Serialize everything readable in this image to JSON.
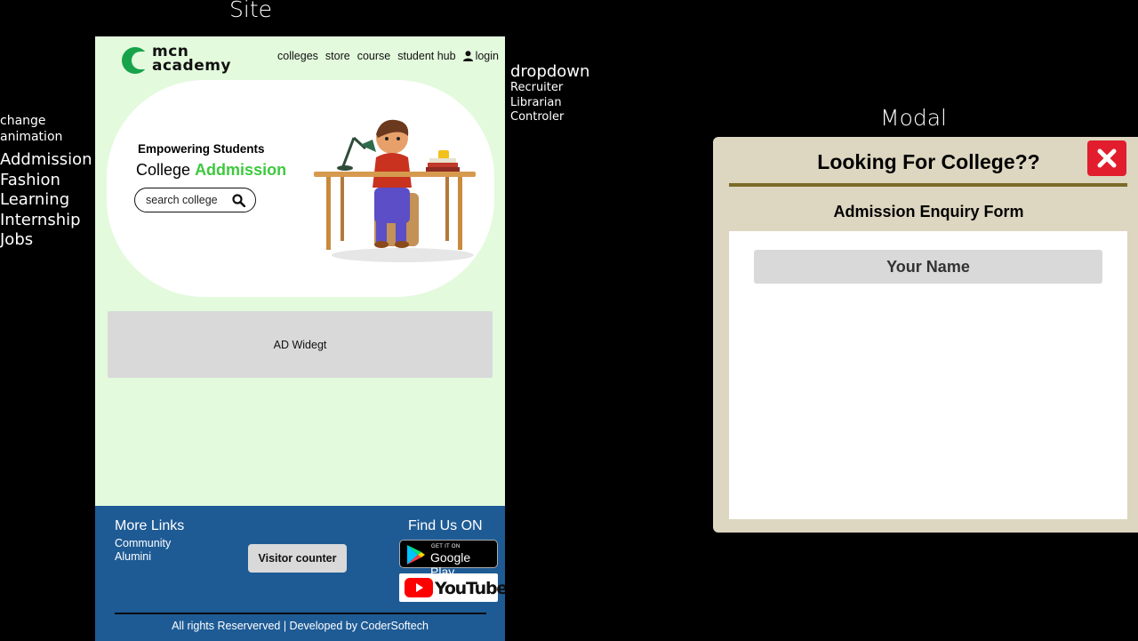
{
  "canvas": {
    "site_title": "Site",
    "modal_title": "Modal",
    "change_animation": "change animation",
    "animation_words": [
      "Addmission",
      "Fashion",
      "Learning",
      "Internship",
      "Jobs"
    ],
    "dropdown": {
      "label": "dropdown",
      "items": [
        "Recruiter",
        "Librarian",
        "Controler"
      ]
    }
  },
  "site": {
    "logo_text_1": "mcn",
    "logo_text_2": "academy",
    "nav": [
      "colleges",
      "store",
      "course",
      "student hub",
      "login"
    ],
    "hero": {
      "kicker": "Empowering Students",
      "line_prefix": "College",
      "line_accent": "Addmission",
      "search_placeholder": "search college"
    },
    "ad_label": "AD Widegt",
    "footer": {
      "more_links": "More Links",
      "links": [
        "Community",
        "Alumini"
      ],
      "visitor_counter": "Visitor counter",
      "find_us": "Find Us ON",
      "gplay_small": "GET IT ON",
      "gplay_big": "Google Play",
      "youtube": "YouTube",
      "copyright": "All rights Reserverved | Developed by CoderSoftech"
    }
  },
  "modal": {
    "heading": "Looking For College??",
    "subheading": "Admission Enquiry Form",
    "name_placeholder": "Your Name"
  },
  "colors": {
    "site_bg": "#e3fadd",
    "accent_green": "#3ec93e",
    "footer_blue": "#1e5b95",
    "modal_bg": "#ddd6c0",
    "close_red": "#e11d2e"
  }
}
